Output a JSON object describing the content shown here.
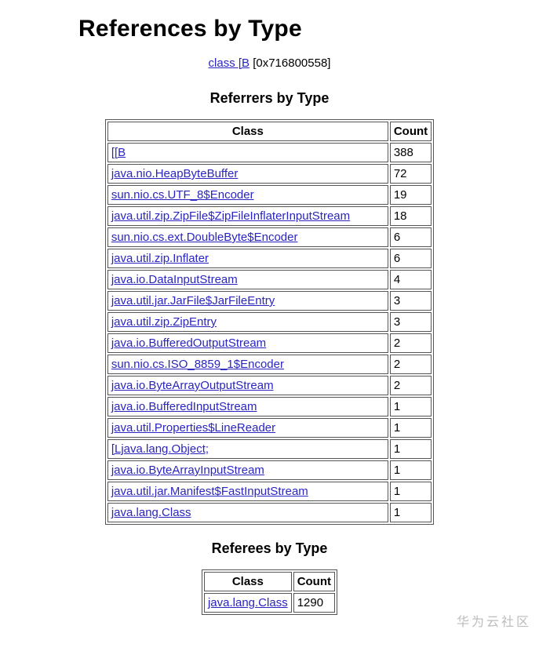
{
  "title": "References by Type",
  "subline": {
    "link_text": "class [B",
    "suffix": " [0x716800558]"
  },
  "referrers": {
    "heading": "Referrers by Type",
    "headers": {
      "class": "Class",
      "count": "Count"
    },
    "rows": [
      {
        "class": "[[B",
        "count": "388"
      },
      {
        "class": "java.nio.HeapByteBuffer",
        "count": "72"
      },
      {
        "class": "sun.nio.cs.UTF_8$Encoder",
        "count": "19"
      },
      {
        "class": "java.util.zip.ZipFile$ZipFileInflaterInputStream",
        "count": "18"
      },
      {
        "class": "sun.nio.cs.ext.DoubleByte$Encoder",
        "count": "6"
      },
      {
        "class": "java.util.zip.Inflater",
        "count": "6"
      },
      {
        "class": "java.io.DataInputStream",
        "count": "4"
      },
      {
        "class": "java.util.jar.JarFile$JarFileEntry",
        "count": "3"
      },
      {
        "class": "java.util.zip.ZipEntry",
        "count": "3"
      },
      {
        "class": "java.io.BufferedOutputStream",
        "count": "2"
      },
      {
        "class": "sun.nio.cs.ISO_8859_1$Encoder",
        "count": "2"
      },
      {
        "class": "java.io.ByteArrayOutputStream",
        "count": "2"
      },
      {
        "class": "java.io.BufferedInputStream",
        "count": "1"
      },
      {
        "class": "java.util.Properties$LineReader",
        "count": "1"
      },
      {
        "class": "[Ljava.lang.Object;",
        "count": "1"
      },
      {
        "class": "java.io.ByteArrayInputStream",
        "count": "1"
      },
      {
        "class": "java.util.jar.Manifest$FastInputStream",
        "count": "1"
      },
      {
        "class": "java.lang.Class",
        "count": "1"
      }
    ]
  },
  "referees": {
    "heading": "Referees by Type",
    "headers": {
      "class": "Class",
      "count": "Count"
    },
    "rows": [
      {
        "class": "java.lang.Class",
        "count": "1290"
      }
    ]
  },
  "watermark": "华为云社区"
}
